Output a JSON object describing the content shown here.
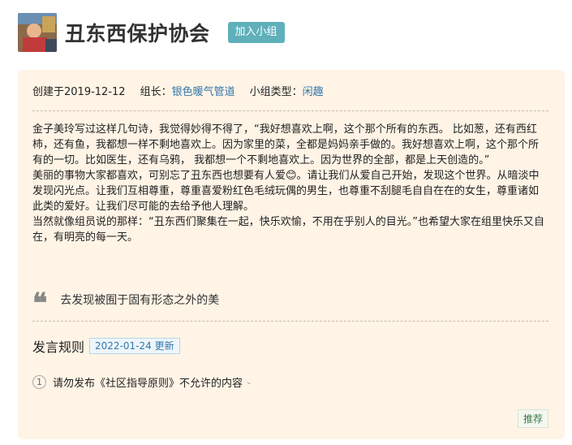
{
  "header": {
    "title": "丑东西保护协会",
    "join_label": "加入小组"
  },
  "meta": {
    "created_label": "创建于2019-12-12",
    "leader_label": "组长：",
    "leader_name": "银色暖气管道",
    "type_label": "小组类型：",
    "type_value": "闲趣"
  },
  "description": [
    "金子美玲写过这样几句诗，我觉得妙得不得了，“我好想喜欢上啊，这个那个所有的东西。 比如葱，还有西红柿，还有鱼，我都想一样不剩地喜欢上。因为家里的菜，全都是妈妈亲手做的。我好想喜欢上啊，这个那个所有的一切。比如医生，还有乌鸦， 我都想一个不剩地喜欢上。因为世界的全部，都是上天创造的。”",
    "美丽的事物大家都喜欢，可别忘了丑东西也想要有人爱😊。请让我们从爱自己开始，发现这个世界。从暗淡中发现闪光点。让我们互相尊重，尊重喜爱粉红色毛绒玩偶的男生，也尊重不刮腿毛自自在在的女生，尊重诸如此类的爱好。让我们尽可能的去给予他人理解。",
    "当然就像组员说的那样：“丑东西们聚集在一起，快乐欢愉，不用在乎别人的目光。”也希望大家在组里快乐又自在，有明亮的每一天。"
  ],
  "quote": {
    "mark": "❝",
    "text": "去发现被囿于固有形态之外的美"
  },
  "rules": {
    "title": "发言规则",
    "updated_badge": "2022-01-24 更新",
    "items": [
      {
        "num": "1",
        "text": "请勿发布《社区指导原则》不允许的内容",
        "chevron": "⌄"
      }
    ]
  },
  "footer": {
    "recommend_label": "推荐"
  },
  "colors": {
    "accent": "#5fb0ba",
    "card_bg": "#fff4e6",
    "link": "#3377aa"
  }
}
